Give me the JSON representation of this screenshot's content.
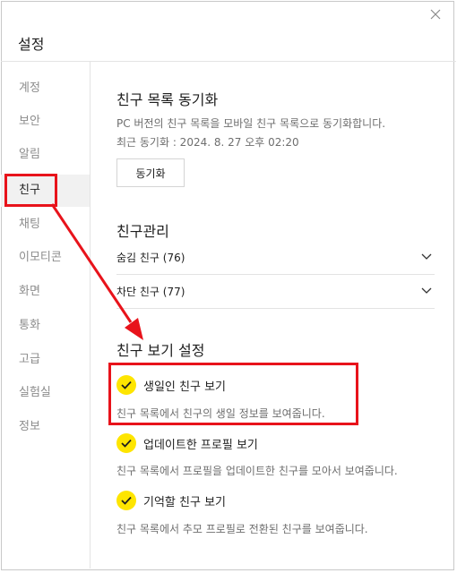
{
  "window": {
    "title": "설정",
    "close_icon": "close-icon"
  },
  "sidebar": {
    "items": [
      {
        "label": "계정"
      },
      {
        "label": "보안"
      },
      {
        "label": "알림"
      },
      {
        "label": "친구",
        "active": true
      },
      {
        "label": "채팅"
      },
      {
        "label": "이모티콘"
      },
      {
        "label": "화면"
      },
      {
        "label": "통화"
      },
      {
        "label": "고급"
      },
      {
        "label": "실험실"
      },
      {
        "label": "정보"
      }
    ]
  },
  "sync": {
    "title": "친구 목록 동기화",
    "description": "PC 버전의 친구 목록을 모바일 친구 목록으로 동기화합니다.",
    "last_sync": "최근 동기화 : 2024. 8. 27 오후 02:20",
    "button_label": "동기화"
  },
  "manage": {
    "title": "친구관리",
    "rows": [
      {
        "label": "숨김 친구 (76)"
      },
      {
        "label": "차단 친구 (77)"
      }
    ]
  },
  "view": {
    "title": "친구 보기 설정",
    "options": [
      {
        "label": "생일인 친구 보기",
        "checked": true,
        "description": "친구 목록에서 친구의 생일 정보를 보여줍니다."
      },
      {
        "label": "업데이트한 프로필 보기",
        "checked": true,
        "description": "친구 목록에서 프로필을 업데이트한 친구를 모아서 보여줍니다."
      },
      {
        "label": "기억할 친구 보기",
        "checked": true,
        "description": "친구 목록에서 추모 프로필로 전환된 친구를 보여줍니다."
      }
    ]
  },
  "colors": {
    "accent_check": "#fee500",
    "annotation": "#e8131b",
    "active_bg": "#f1f1f1"
  }
}
